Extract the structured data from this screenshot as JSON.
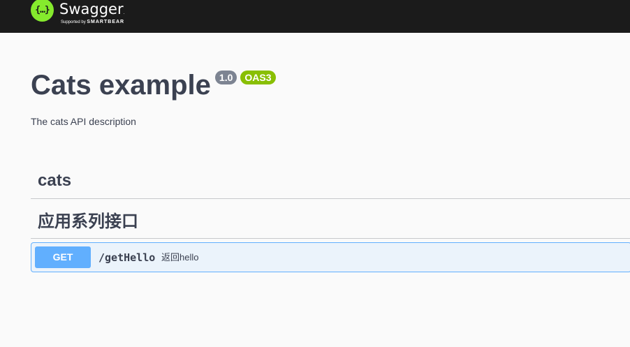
{
  "topbar": {
    "logo_icon_text": "{…}",
    "logo_name": "Swagger",
    "logo_tm": ".",
    "logo_sub_prefix": "Supported by",
    "logo_sub_brand": "SMARTBEAR"
  },
  "info": {
    "title": "Cats example",
    "version": "1.0",
    "oas": "OAS3",
    "description": "The cats API description"
  },
  "tags": [
    {
      "name": "cats"
    },
    {
      "name": "应用系列接口"
    }
  ],
  "operations": [
    {
      "method": "GET",
      "path": "/getHello",
      "summary": "返回hello"
    }
  ],
  "colors": {
    "topbar": "#1b1b1b",
    "logo_green": "#85ea2d",
    "get_blue": "#61affe",
    "get_bg": "#ebf3fb",
    "version_badge": "#7d8492",
    "oas_badge": "#89bf04",
    "text": "#3b4151"
  }
}
